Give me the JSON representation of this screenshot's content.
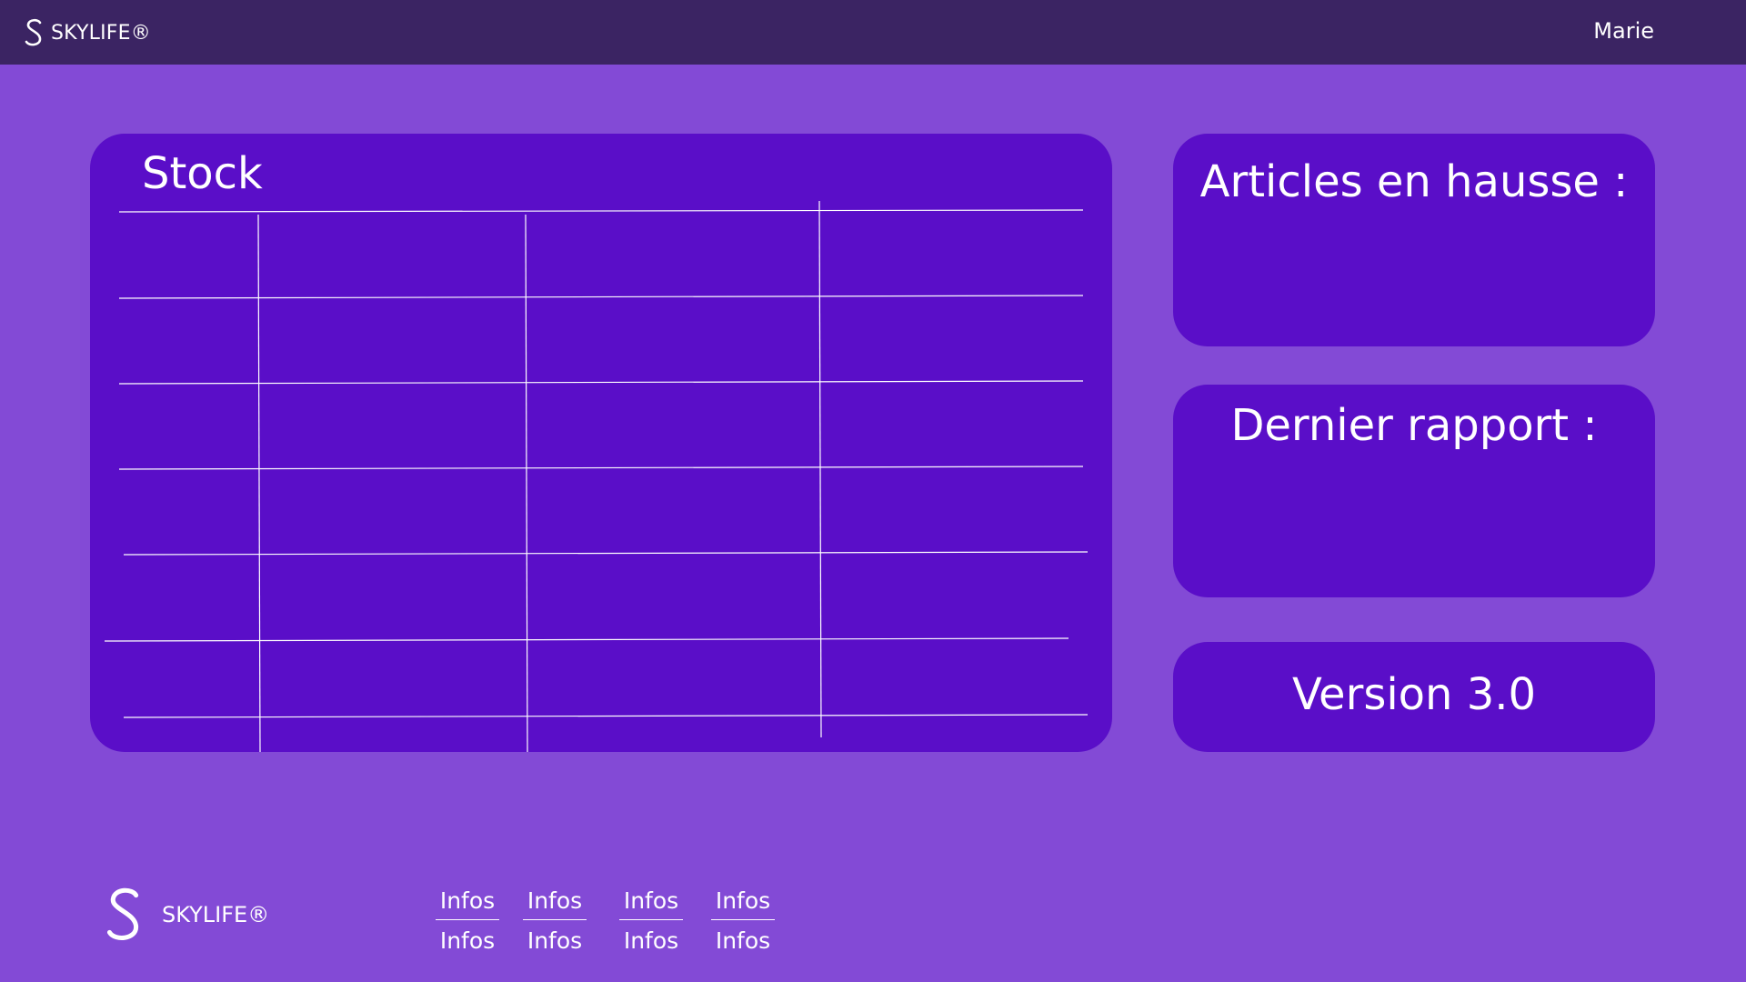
{
  "header": {
    "brand": "SKYLIFE®",
    "user": "Marie"
  },
  "stock": {
    "title": "Stock"
  },
  "side_panels": {
    "trending_title": "Articles en hausse :",
    "report_title": "Dernier rapport :",
    "version_label": "Version 3.0"
  },
  "footer": {
    "brand": "SKYLIFE®",
    "links": [
      {
        "top": "Infos",
        "bottom": "Infos"
      },
      {
        "top": "Infos",
        "bottom": "Infos"
      },
      {
        "top": "Infos",
        "bottom": "Infos"
      },
      {
        "top": "Infos",
        "bottom": "Infos"
      }
    ]
  },
  "colors": {
    "header_bg": "#3b2463",
    "page_bg": "#834ad6",
    "card_bg": "#5a0ec8",
    "text": "#ffffff"
  }
}
